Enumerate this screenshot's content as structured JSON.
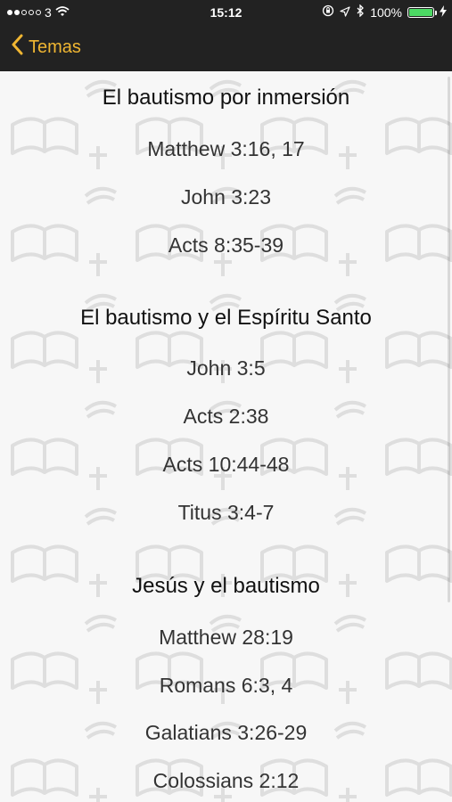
{
  "status_bar": {
    "carrier": "3",
    "time": "15:12",
    "battery_percent_text": "100%",
    "battery_level": 1.0,
    "signal_bars_filled": 2,
    "signal_bars_total": 5
  },
  "nav": {
    "back_label": "Temas",
    "accent_color": "#f0b632"
  },
  "sections": [
    {
      "title": "El bautismo por inmersión",
      "verses": [
        "Matthew 3:16, 17",
        "John 3:23",
        "Acts 8:35-39"
      ]
    },
    {
      "title": "El bautismo y el Espíritu Santo",
      "verses": [
        "John 3:5",
        "Acts 2:38",
        "Acts 10:44-48",
        "Titus 3:4-7"
      ]
    },
    {
      "title": "Jesús y el bautismo",
      "verses": [
        "Matthew 28:19",
        "Romans 6:3, 4",
        "Galatians 3:26-29",
        "Colossians 2:12"
      ]
    }
  ],
  "icons": {
    "back": "chevron-left-icon",
    "wifi": "wifi-icon",
    "rotation_lock": "rotation-lock-icon",
    "location": "location-arrow-icon",
    "bluetooth": "bluetooth-icon",
    "battery": "battery-icon",
    "charging": "charging-bolt-icon",
    "watermark": "bible-pattern-icon"
  }
}
